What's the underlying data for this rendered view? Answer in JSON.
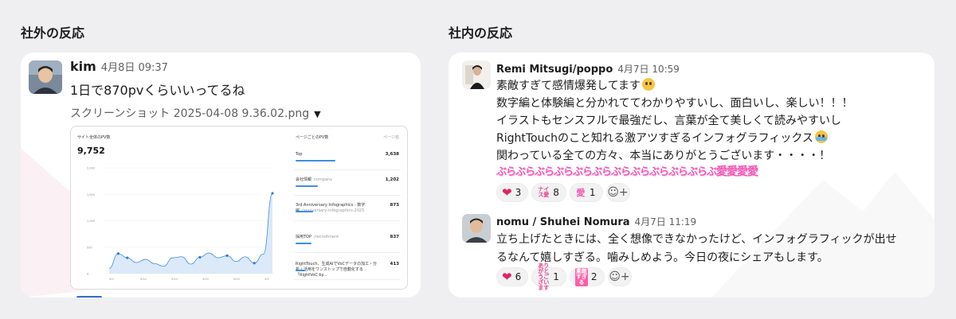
{
  "sections": {
    "external_title": "社外の反応",
    "internal_title": "社内の反応"
  },
  "external_message": {
    "user": "kim",
    "time": "4月8日 09:37",
    "text": "1日で870pvくらいいってるね",
    "file_name": "スクリーンショット 2025-04-08 9.36.02.png",
    "screenshot": {
      "left_title": "サイト全体のPV数",
      "total": "9,752",
      "y_ticks": [
        "2,000",
        "1,500",
        "1,000",
        "500",
        "0"
      ],
      "x_ticks": [
        "3/9",
        "3/14",
        "3/19",
        "3/24",
        "3/29",
        "4/3"
      ],
      "right_title": "ページごとのPV数",
      "right_link": "ページ名",
      "rows": [
        {
          "label": "Top",
          "sub": "",
          "value": "3,638"
        },
        {
          "label": "会社情報",
          "sub": "company",
          "value": "1,202"
        },
        {
          "label": "3rd Anniversary Infographics - 数字編",
          "sub": "/anniversary-infographics-2025",
          "value": "873"
        },
        {
          "label": "採用TOP",
          "sub": "/recruitment",
          "value": "837"
        },
        {
          "label": "RightTouch、生成AIでVoCデータの加工・分析・活用をワンストップで自動化する「RightVoC by...",
          "sub": "",
          "value": "413"
        }
      ]
    },
    "chart_data": {
      "type": "area",
      "title": "サイト全体のPV数",
      "x": [
        "3/9",
        "3/14",
        "3/19",
        "3/24",
        "3/29",
        "4/3"
      ],
      "ylim": [
        0,
        2000
      ],
      "series": [
        {
          "name": "PV",
          "values": [
            100,
            380,
            300,
            210,
            270,
            190,
            140,
            300,
            320,
            180,
            310,
            390,
            300,
            340,
            230,
            320,
            200,
            370,
            1520
          ]
        }
      ]
    }
  },
  "internal_messages": [
    {
      "user": "Remi Mitsugi/poppo",
      "time": "4月7日 10:59",
      "lines": [
        "素敵すぎて感情爆発してます",
        "数字編と体験編と分かれててわかりやすいし、面白いし、楽しい！！！",
        "イラストもセンスフルで最強だし、言葉が全て美しくて読みやすいし",
        "RightTouchのこと知れる激アツすぎるインフォグラフィックス",
        "関わっている全ての方々、本当にありがとうございます・・・・！"
      ],
      "custom_emoji_text": "ぶらぶらぶらぶらぶらぶらぶらぶらぶらぶらぶらぶ",
      "custom_emoji_love": "愛愛愛愛",
      "reactions": [
        {
          "emoji": "heart",
          "count": "3"
        },
        {
          "emoji": "ナイス愛",
          "count": "8"
        },
        {
          "emoji": "愛",
          "count": "1"
        }
      ]
    },
    {
      "user": "nomu / Shuhei Nomura",
      "time": "4月7日 11:19",
      "lines": [
        "立ち上げたときには、全く想像できなかったけど、インフォグラフィックが出せ",
        "るなんて嬉しすぎる。噛みしめよう。今日の夜にシェアもします。"
      ],
      "reactions": [
        {
          "emoji": "heart",
          "count": "6"
        },
        {
          "emoji": "ありがとうございます",
          "count": "1"
        },
        {
          "emoji": "素敵すぎる",
          "count": "2"
        }
      ]
    }
  ],
  "colors": {
    "background": "#efeff1",
    "card": "#ffffff",
    "heart": "#e0245e",
    "custom_emoji_pink": "#f05ab5",
    "chart_blue": "#3d8fe0"
  }
}
